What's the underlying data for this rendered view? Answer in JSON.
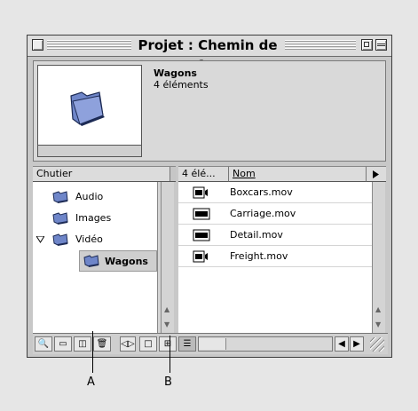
{
  "window": {
    "title": "Projet : Chemin de fer"
  },
  "header": {
    "name": "Wagons",
    "count": "4 éléments"
  },
  "bin_pane": {
    "column_label": "Chutier",
    "items": [
      {
        "label": "Audio"
      },
      {
        "label": "Images"
      },
      {
        "label": "Vidéo"
      },
      {
        "label": "Wagons"
      }
    ]
  },
  "clip_pane": {
    "count_label": "4 élé...",
    "name_column": "Nom",
    "items": [
      {
        "label": "Boxcars.mov",
        "icon": "audio-video-clip-icon"
      },
      {
        "label": "Carriage.mov",
        "icon": "video-clip-icon"
      },
      {
        "label": "Detail.mov",
        "icon": "video-clip-icon"
      },
      {
        "label": "Freight.mov",
        "icon": "audio-video-clip-icon"
      }
    ]
  },
  "callouts": {
    "a": "A",
    "b": "B"
  },
  "colors": {
    "folder": "#6f86c9",
    "window_bg": "#c8c8c8",
    "selection": "#cfcfcf"
  }
}
